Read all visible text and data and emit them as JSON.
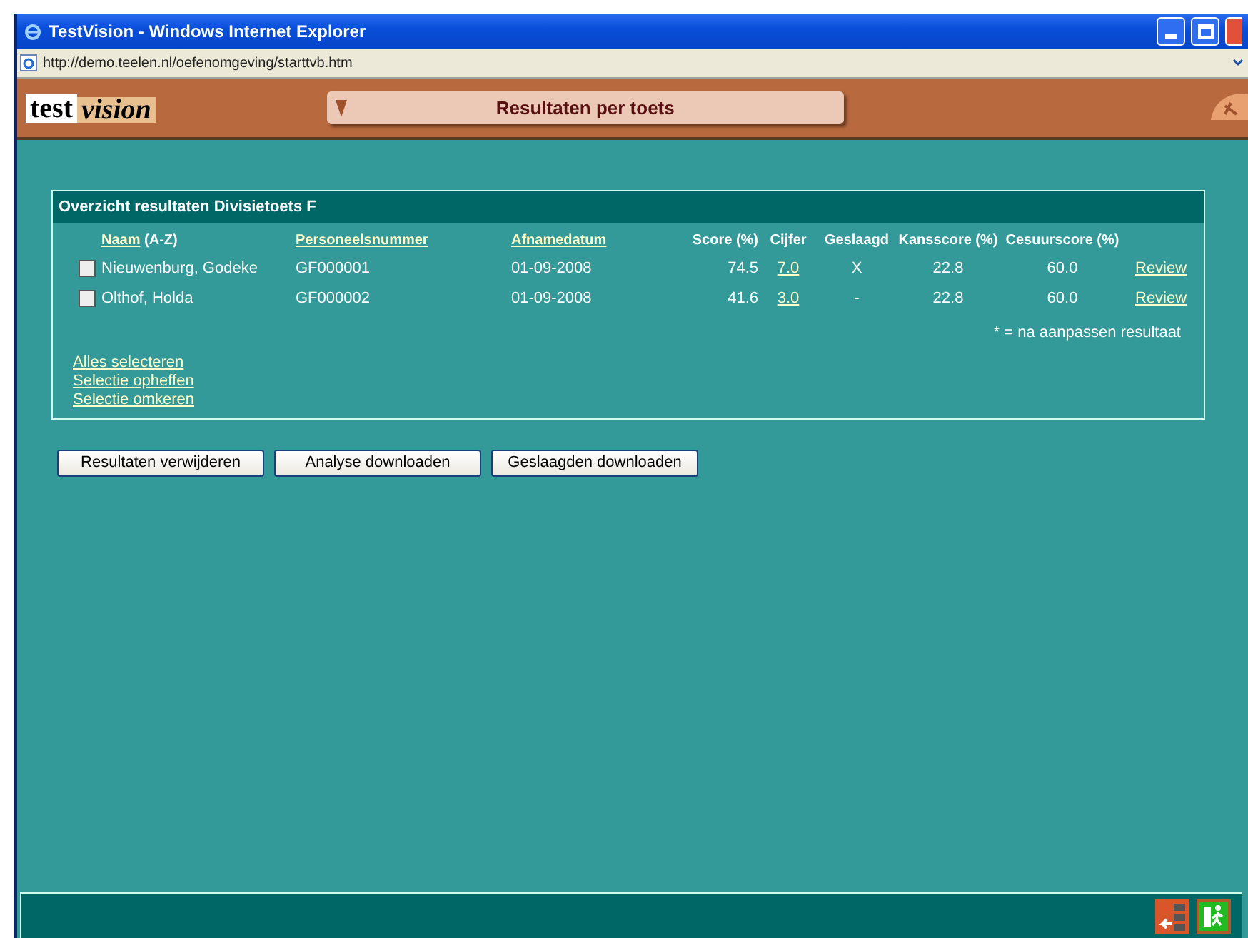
{
  "window": {
    "title": "TestVision - Windows Internet Explorer",
    "address": "http://demo.teelen.nl/oefenomgeving/starttvb.htm"
  },
  "header": {
    "logo_left": "test",
    "logo_right": "vision",
    "menu_title": "Resultaten per toets"
  },
  "panel": {
    "title": "Overzicht resultaten Divisietoets F",
    "columns": [
      {
        "label": "Naam",
        "suffix": "(A-Z)",
        "link": true
      },
      {
        "label": "Personeelsnummer",
        "link": true
      },
      {
        "label": "Afnamedatum",
        "link": true
      },
      {
        "label": "Score (%)",
        "link": false
      },
      {
        "label": "Cijfer",
        "link": false
      },
      {
        "label": "Geslaagd",
        "link": false
      },
      {
        "label": "Kansscore (%)",
        "link": false
      },
      {
        "label": "Cesuurscore (%)",
        "link": false
      }
    ],
    "rows": [
      {
        "checked": false,
        "name": "Nieuwenburg, Godeke",
        "number": "GF000001",
        "date": "01-09-2008",
        "score": "74.5",
        "grade": "7.0",
        "passed": "X",
        "chance": "22.8",
        "cutoff": "60.0",
        "review": "Review"
      },
      {
        "checked": false,
        "name": "Olthof, Holda",
        "number": "GF000002",
        "date": "01-09-2008",
        "score": "41.6",
        "grade": "3.0",
        "passed": "-",
        "chance": "22.8",
        "cutoff": "60.0",
        "review": "Review"
      }
    ],
    "footnote": "* = na aanpassen resultaat",
    "links": [
      "Alles selecteren",
      "Selectie opheffen",
      "Selectie omkeren"
    ]
  },
  "buttons": [
    "Resultaten verwijderen",
    "Analyse downloaden",
    "Geslaagden downloaden"
  ]
}
